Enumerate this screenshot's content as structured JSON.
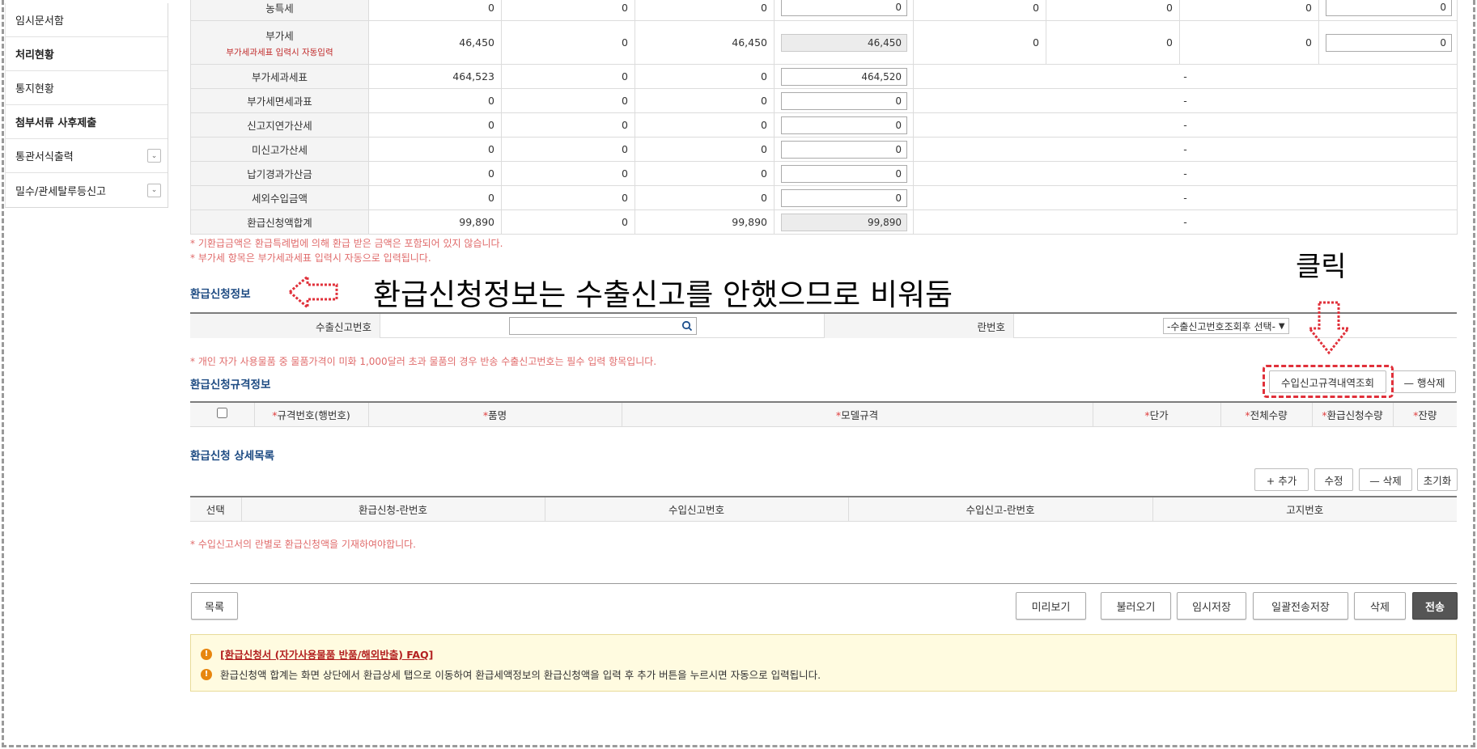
{
  "sidebar": {
    "items": [
      {
        "label": "임시문서함"
      },
      {
        "label": "처리현황"
      },
      {
        "label": "통지현황"
      },
      {
        "label": "첨부서류 사후제출"
      },
      {
        "label": "통관서식출력"
      },
      {
        "label": "밀수/관세탈루등신고"
      }
    ]
  },
  "tax_table": {
    "rows": [
      {
        "label": "농특세",
        "c1": "0",
        "c2": "0",
        "c3": "0",
        "input": "0",
        "c5": "0",
        "c6": "0",
        "c7": "0",
        "input2": "0"
      },
      {
        "label": "부가세",
        "sublabel": "부가세과세표 입력시 자동입력",
        "c1": "46,450",
        "c2": "0",
        "c3": "46,450",
        "input": "46,450",
        "c5": "0",
        "c6": "0",
        "c7": "0",
        "input2": "0"
      },
      {
        "label": "부가세과세표",
        "c1": "464,523",
        "c2": "0",
        "c3": "0",
        "input": "464,520",
        "dash": "-"
      },
      {
        "label": "부가세면세과표",
        "c1": "0",
        "c2": "0",
        "c3": "0",
        "input": "0",
        "dash": "-"
      },
      {
        "label": "신고지연가산세",
        "c1": "0",
        "c2": "0",
        "c3": "0",
        "input": "0",
        "dash": "-"
      },
      {
        "label": "미신고가산세",
        "c1": "0",
        "c2": "0",
        "c3": "0",
        "input": "0",
        "dash": "-"
      },
      {
        "label": "납기경과가산금",
        "c1": "0",
        "c2": "0",
        "c3": "0",
        "input": "0",
        "dash": "-"
      },
      {
        "label": "세외수입금액",
        "c1": "0",
        "c2": "0",
        "c3": "0",
        "input": "0",
        "dash": "-"
      },
      {
        "label": "환급신청액합계",
        "c1": "99,890",
        "c2": "0",
        "c3": "99,890",
        "input": "99,890",
        "dash": "-"
      }
    ]
  },
  "notes": {
    "n1": "* 기환급금액은 환급특례법에 의해 환급 받은 금액은 포함되어 있지 않습니다.",
    "n2": "* 부가세 항목은 부가세과세표 입력시 자동으로 입력됩니다.",
    "n3": "* 개인 자가 사용물품 중 물품가격이 미화 1,000달러 초과 물품의 경우 반송 수출신고번호는 필수 입력 항목입니다.",
    "n4": "* 수입신고서의 란별로 환급신청액을 기재하여야합니다."
  },
  "refund_info": {
    "title": "환급신청정보",
    "export_no_label": "수출신고번호",
    "export_no_value": "",
    "line_no_label": "란번호",
    "line_no_select": "-수출신고번호조회후 선택-"
  },
  "annotations": {
    "main": "환급신청정보는 수출신고를 안했으므로 비워둠",
    "click": "클릭"
  },
  "spec_info": {
    "title": "환급신청규격정보",
    "lookup_button": "수입신고규격내역조회",
    "delete_row_button": "— 행삭제",
    "columns": [
      "규격번호(행번호)",
      "품명",
      "모델규격",
      "단가",
      "전체수량",
      "환급신청수량",
      "잔량"
    ],
    "required_mark": "*"
  },
  "detail_list": {
    "title": "환급신청 상세목록",
    "buttons": {
      "add": "+ 추가",
      "edit": "수정",
      "delete": "— 삭제",
      "reset": "초기화"
    },
    "columns": [
      "선택",
      "환급신청-란번호",
      "수입신고번호",
      "수입신고-란번호",
      "고지번호"
    ]
  },
  "footer_buttons": {
    "list": "목록",
    "preview": "미리보기",
    "load": "불러오기",
    "temp_save": "임시저장",
    "batch_save": "일괄전송저장",
    "delete": "삭제",
    "send": "전송"
  },
  "info_box": {
    "link": "[환급신청서 (자가사용물품 반품/해외반출) FAQ]",
    "text": "환급신청액 합계는 화면 상단에서 환급상세 탭으로 이동하여 환급세액정보의 환급신청액을 입력 후 추가 버튼을 누르시면 자동으로 입력됩니다."
  },
  "colors": {
    "accent_red": "#e0303a",
    "title_blue": "#1c4a82",
    "note_red": "#e06b6b",
    "info_bg": "#fffbe0"
  }
}
